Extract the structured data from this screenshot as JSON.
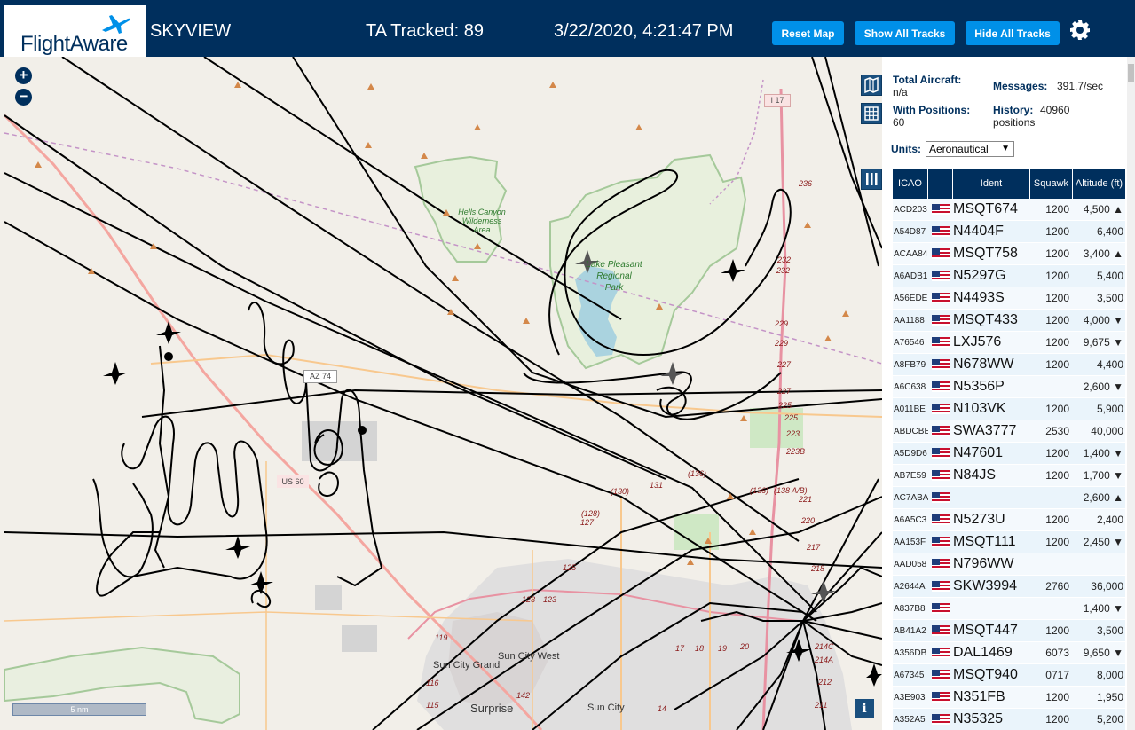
{
  "header": {
    "logo": "FlightAware",
    "site_name": "SKYVIEW",
    "tracked": "TA Tracked: 89",
    "clock": "3/22/2020, 4:21:47 PM",
    "buttons": {
      "reset": "Reset Map",
      "show": "Show All Tracks",
      "hide": "Hide All Tracks"
    }
  },
  "map": {
    "zoom_in": "+",
    "zoom_out": "−",
    "scale": "5 nm",
    "info": "i",
    "labels": {
      "hells_canyon": [
        "Hells Canyon",
        "Wilderness",
        "Area"
      ],
      "lake_pleasant": [
        "Lake Pleasant",
        "Regional",
        "Park"
      ],
      "i17": "I 17",
      "az74": "AZ 74",
      "us60": "US 60",
      "sun_city_grand": "Sun City Grand",
      "sun_city_west": "Sun City West",
      "surprise": "Surprise",
      "sun_city": "Sun City"
    },
    "exits": [
      "236",
      "232",
      "232",
      "229",
      "229",
      "227",
      "227",
      "225",
      "225",
      "223",
      "223B",
      "221",
      "220",
      "217",
      "218",
      "(136)",
      "(136)",
      "(138 A/B)",
      "131",
      "(130)",
      "(128)",
      "127",
      "125",
      "123",
      "123",
      "119",
      "116",
      "115",
      "142",
      "14",
      "17",
      "18",
      "19",
      "20",
      "212",
      "214A",
      "214C",
      "211"
    ]
  },
  "stats": {
    "total_label": "Total Aircraft:",
    "total_val": "n/a",
    "with_label": "With Positions:",
    "with_val": "60",
    "messages_label": "Messages:",
    "messages_val": "391.7/sec",
    "history_label": "History:",
    "history_val1": "40960",
    "history_val2": "positions",
    "units_label": "Units:",
    "units_value": "Aeronautical"
  },
  "table": {
    "columns": [
      "ICAO",
      "Ident",
      "Squawk",
      "Altitude (ft)"
    ],
    "rows": [
      {
        "icao": "ACD203",
        "ident": "MSQT674",
        "squawk": "1200",
        "alt": "4,500 ▲"
      },
      {
        "icao": "A54D87",
        "ident": "N4404F",
        "squawk": "1200",
        "alt": "6,400"
      },
      {
        "icao": "ACAA84",
        "ident": "MSQT758",
        "squawk": "1200",
        "alt": "3,400 ▲"
      },
      {
        "icao": "A6ADB1",
        "ident": "N5297G",
        "squawk": "1200",
        "alt": "5,400"
      },
      {
        "icao": "A56EDE",
        "ident": "N4493S",
        "squawk": "1200",
        "alt": "3,500"
      },
      {
        "icao": "AA1188",
        "ident": "MSQT433",
        "squawk": "1200",
        "alt": "4,000 ▼"
      },
      {
        "icao": "A76546",
        "ident": "LXJ576",
        "squawk": "1200",
        "alt": "9,675 ▼"
      },
      {
        "icao": "A8FB79",
        "ident": "N678WW",
        "squawk": "1200",
        "alt": "4,400"
      },
      {
        "icao": "A6C638",
        "ident": "N5356P",
        "squawk": "",
        "alt": "2,600 ▼"
      },
      {
        "icao": "A011BE",
        "ident": "N103VK",
        "squawk": "1200",
        "alt": "5,900"
      },
      {
        "icao": "ABDCBE",
        "ident": "SWA3777",
        "squawk": "2530",
        "alt": "40,000"
      },
      {
        "icao": "A5D9D6",
        "ident": "N47601",
        "squawk": "1200",
        "alt": "1,400 ▼"
      },
      {
        "icao": "AB7E59",
        "ident": "N84JS",
        "squawk": "1200",
        "alt": "1,700 ▼"
      },
      {
        "icao": "AC7ABA",
        "ident": "",
        "squawk": "",
        "alt": "2,600 ▲"
      },
      {
        "icao": "A6A5C3",
        "ident": "N5273U",
        "squawk": "1200",
        "alt": "2,400"
      },
      {
        "icao": "AA153F",
        "ident": "MSQT111",
        "squawk": "1200",
        "alt": "2,450 ▼"
      },
      {
        "icao": "AAD058",
        "ident": "N796WW",
        "squawk": "",
        "alt": ""
      },
      {
        "icao": "A2644A",
        "ident": "SKW3994",
        "squawk": "2760",
        "alt": "36,000"
      },
      {
        "icao": "A837B8",
        "ident": "",
        "squawk": "",
        "alt": "1,400 ▼"
      },
      {
        "icao": "AB41A2",
        "ident": "MSQT447",
        "squawk": "1200",
        "alt": "3,500"
      },
      {
        "icao": "A356DB",
        "ident": "DAL1469",
        "squawk": "6073",
        "alt": "9,650 ▼"
      },
      {
        "icao": "A67345",
        "ident": "MSQT940",
        "squawk": "0717",
        "alt": "8,000"
      },
      {
        "icao": "A3E903",
        "ident": "N351FB",
        "squawk": "1200",
        "alt": "1,950"
      },
      {
        "icao": "A352A5",
        "ident": "N35325",
        "squawk": "1200",
        "alt": "5,200"
      }
    ]
  },
  "colors": {
    "header_bg": "#002f5d",
    "button": "#0090e8",
    "map_bg": "#f2efe9"
  }
}
